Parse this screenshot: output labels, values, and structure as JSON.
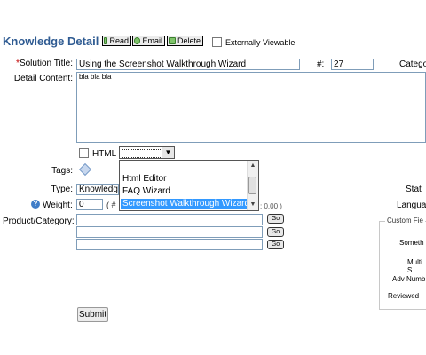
{
  "header": {
    "title": "Knowledge Detail",
    "read_label": "Read",
    "email_label": "Email",
    "delete_label": "Delete",
    "externally_viewable_label": "Externally Viewable"
  },
  "form": {
    "solution_title_label": "*Solution Title:",
    "solution_title_value": "Using the Screenshot Walkthrough Wizard",
    "number_label": "#:",
    "number_value": "27",
    "category_label": "Catego",
    "detail_content_label": "Detail Content:",
    "detail_content_value": "bla bla bla",
    "html_label": "HTML",
    "tags_label": "Tags:",
    "type_label": "Type:",
    "type_value": "Knowledg",
    "weight_label": "Weight:",
    "weight_value": "0",
    "weight_hint_prefix": "( #",
    "weight_hint_suffix": ": 0.00 )",
    "product_category_label": "Product/Category:",
    "go_label": "Go",
    "status_label": "Stat",
    "language_label": "Langua",
    "submit_label": "Submit"
  },
  "editor_dropdown": {
    "options": [
      "Html Editor",
      "FAQ Wizard",
      "Screenshot Walkthrough Wizard"
    ],
    "selected": "Screenshot Walkthrough Wizard"
  },
  "custom_fields": {
    "legend": "Custom Fie",
    "something_label": "Someth",
    "multi_label": "Multi S",
    "adv_number_label": "Adv Numb",
    "reviewed_label": "Reviewed"
  },
  "colors": {
    "title": "#2f5b92",
    "required": "#c00000",
    "selection": "#3399ff"
  }
}
